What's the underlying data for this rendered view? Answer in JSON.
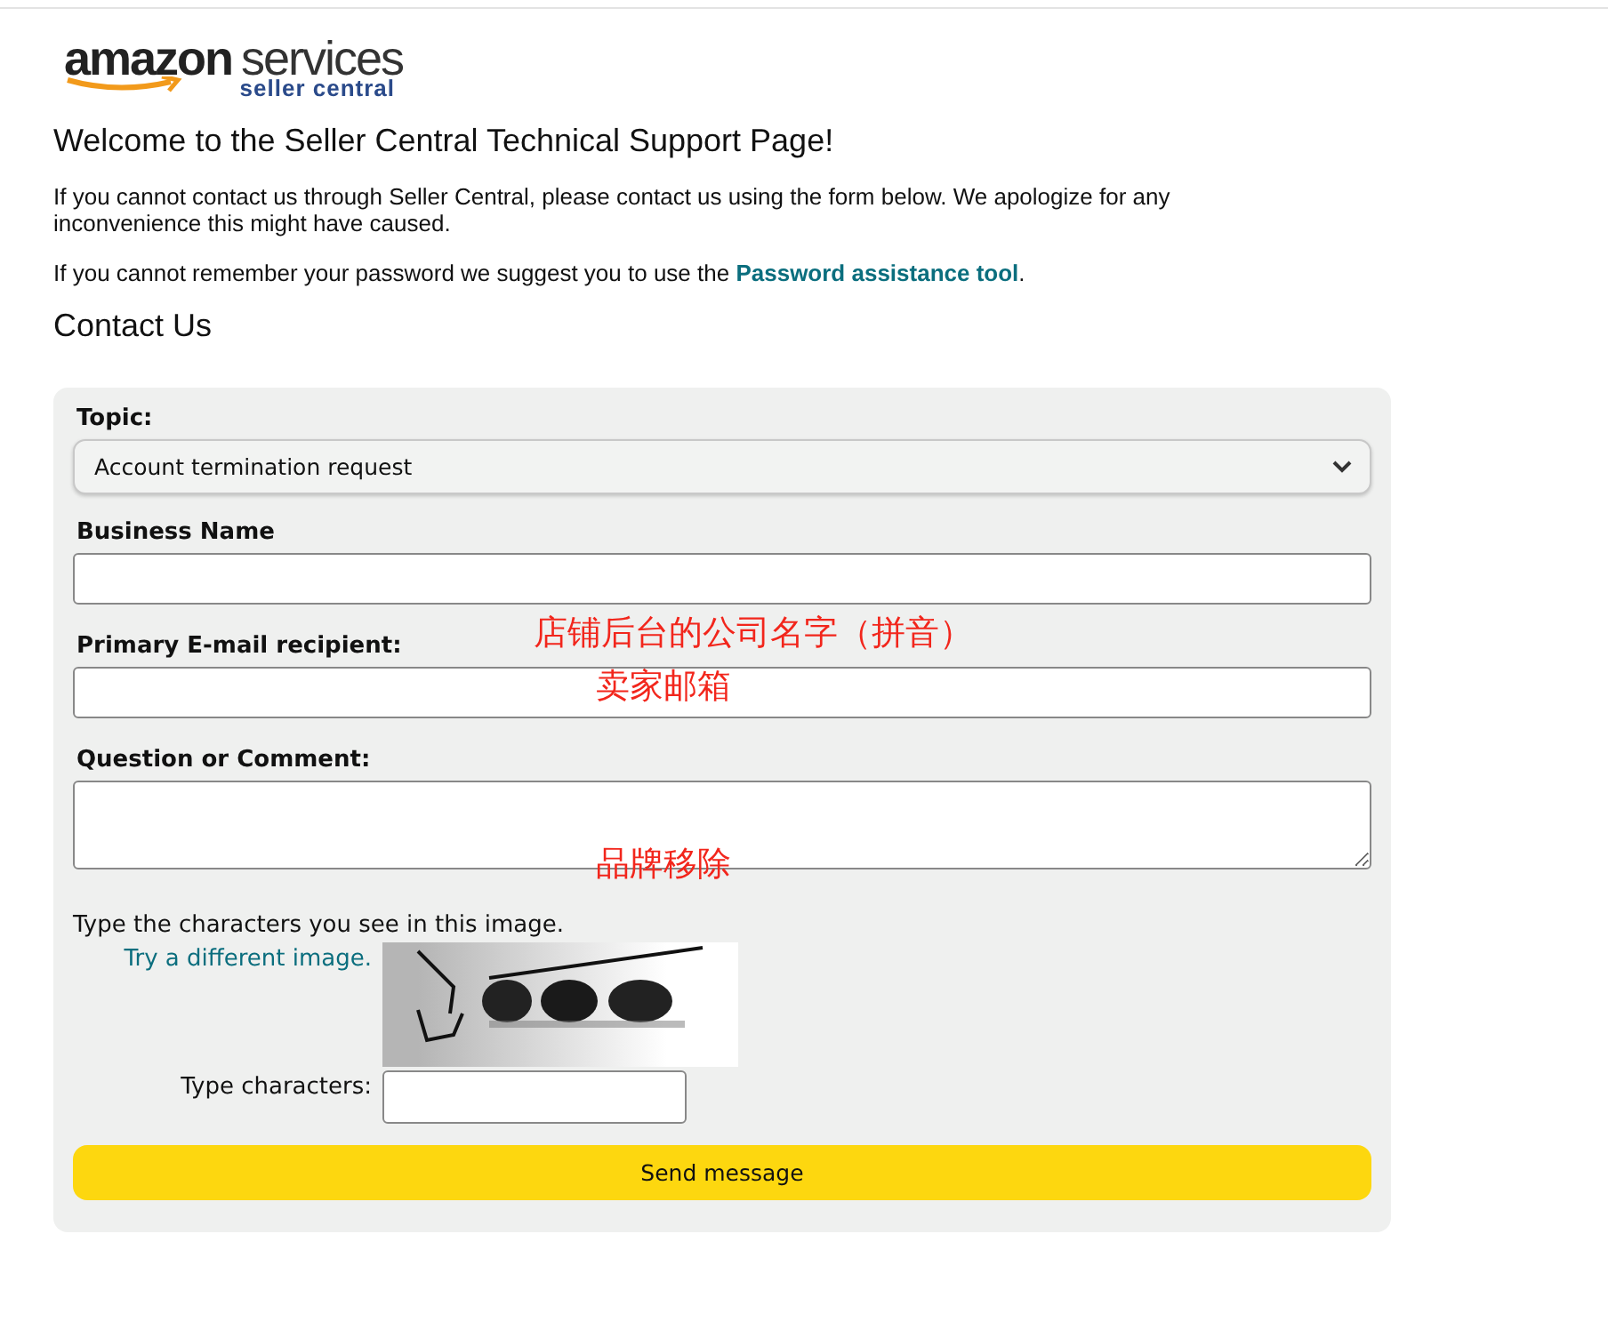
{
  "logo": {
    "brand": "amazon",
    "product": "services",
    "sub": "seller central"
  },
  "heading": "Welcome to the Seller Central Technical Support Page!",
  "intro": "If you cannot contact us through Seller Central, please contact us using the form below. We apologize for any inconvenience this might have caused.",
  "password_note": {
    "before": "If you cannot remember your password we suggest you to use the ",
    "link": "Password assistance tool",
    "after": "."
  },
  "contact_heading": "Contact Us",
  "form": {
    "topic": {
      "label": "Topic:",
      "value": "Account termination request"
    },
    "fields": [
      {
        "label": "Business Name",
        "kind": "input",
        "annotation": "店铺后台的公司名字（拼音）"
      },
      {
        "label": "Primary E-mail recipient:",
        "kind": "input",
        "annotation": "卖家邮箱"
      },
      {
        "label": "Question or Comment:",
        "kind": "textarea",
        "annotation": "品牌移除"
      }
    ],
    "captcha": {
      "instruction": "Type the characters you see in this image.",
      "retry_link": "Try a different image.",
      "input_label": "Type characters:"
    },
    "submit": "Send message"
  }
}
